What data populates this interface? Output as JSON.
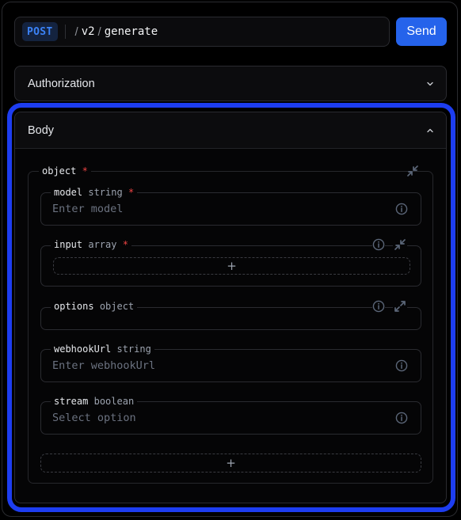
{
  "request": {
    "method": "POST",
    "path_segments": [
      "v2",
      "generate"
    ],
    "send_label": "Send"
  },
  "authorization": {
    "title": "Authorization",
    "expanded": false
  },
  "body": {
    "title": "Body",
    "expanded": true,
    "object": {
      "name": "object",
      "required_mark": "*",
      "fields": [
        {
          "name": "model",
          "type": "string",
          "required_mark": "*",
          "placeholder": "Enter model"
        },
        {
          "name": "input",
          "type": "array",
          "required_mark": "*",
          "add_label": "+"
        },
        {
          "name": "options",
          "type": "object"
        },
        {
          "name": "webhookUrl",
          "type": "string",
          "placeholder": "Enter webhookUrl"
        },
        {
          "name": "stream",
          "type": "boolean",
          "placeholder": "Select option"
        }
      ],
      "add_label": "+"
    }
  },
  "colors": {
    "accent": "#2563eb",
    "highlight": "#1d3df0",
    "required": "#ef4444"
  }
}
